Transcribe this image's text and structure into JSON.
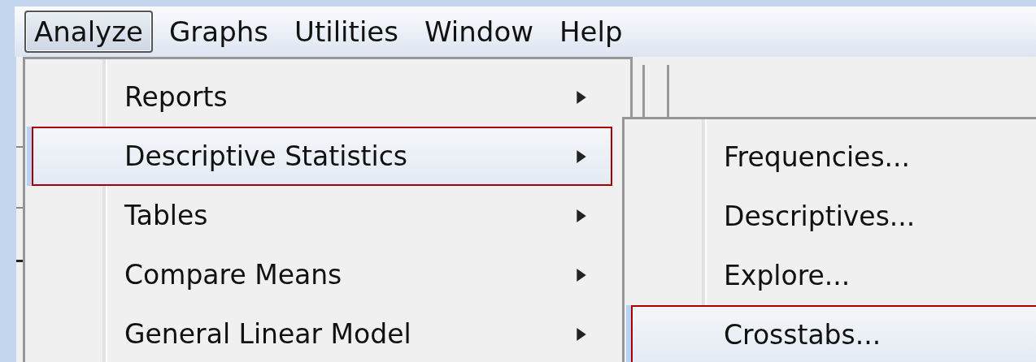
{
  "menu_bar": [
    {
      "label": "Analyze",
      "selected": true
    },
    {
      "label": "Graphs",
      "selected": false
    },
    {
      "label": "Utilities",
      "selected": false
    },
    {
      "label": "Window",
      "selected": false
    },
    {
      "label": "Help",
      "selected": false
    }
  ],
  "menu": {
    "items": [
      {
        "label": "Reports",
        "has_submenu": true,
        "selected": false
      },
      {
        "label": "Descriptive Statistics",
        "has_submenu": true,
        "selected": true
      },
      {
        "label": "Tables",
        "has_submenu": true,
        "selected": false
      },
      {
        "label": "Compare Means",
        "has_submenu": true,
        "selected": false
      },
      {
        "label": "General Linear Model",
        "has_submenu": true,
        "selected": false
      }
    ]
  },
  "submenu": {
    "items": [
      {
        "label": "Frequencies...",
        "selected": false
      },
      {
        "label": "Descriptives...",
        "selected": false
      },
      {
        "label": "Explore...",
        "selected": false
      },
      {
        "label": "Crosstabs...",
        "selected": true
      }
    ]
  }
}
